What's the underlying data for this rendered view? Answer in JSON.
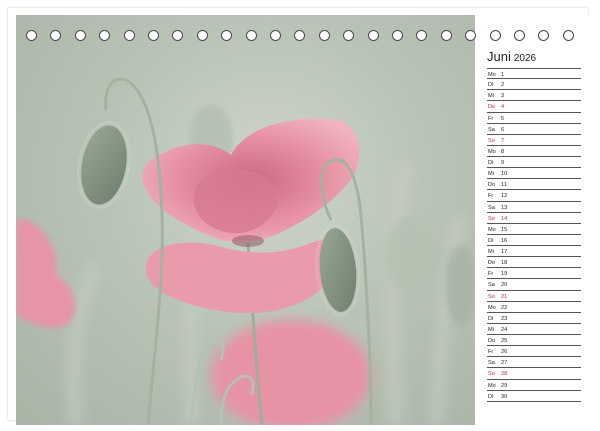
{
  "calendar": {
    "month": "Juni",
    "year": "2026",
    "ring_count": 23,
    "holiday_color": "#c8283a",
    "days": [
      {
        "wd": "Mo",
        "dn": "1",
        "hol": false
      },
      {
        "wd": "Di",
        "dn": "2",
        "hol": false
      },
      {
        "wd": "Mi",
        "dn": "3",
        "hol": false
      },
      {
        "wd": "Do",
        "dn": "4",
        "hol": true
      },
      {
        "wd": "Fr",
        "dn": "5",
        "hol": false
      },
      {
        "wd": "Sa",
        "dn": "6",
        "hol": false
      },
      {
        "wd": "So",
        "dn": "7",
        "hol": true
      },
      {
        "wd": "Mo",
        "dn": "8",
        "hol": false
      },
      {
        "wd": "Di",
        "dn": "9",
        "hol": false
      },
      {
        "wd": "Mi",
        "dn": "10",
        "hol": false
      },
      {
        "wd": "Do",
        "dn": "11",
        "hol": false
      },
      {
        "wd": "Fr",
        "dn": "12",
        "hol": false
      },
      {
        "wd": "Sa",
        "dn": "13",
        "hol": false
      },
      {
        "wd": "So",
        "dn": "14",
        "hol": true
      },
      {
        "wd": "Mo",
        "dn": "15",
        "hol": false
      },
      {
        "wd": "Di",
        "dn": "16",
        "hol": false
      },
      {
        "wd": "Mi",
        "dn": "17",
        "hol": false
      },
      {
        "wd": "Do",
        "dn": "18",
        "hol": false
      },
      {
        "wd": "Fr",
        "dn": "19",
        "hol": false
      },
      {
        "wd": "Sa",
        "dn": "20",
        "hol": false
      },
      {
        "wd": "So",
        "dn": "21",
        "hol": true
      },
      {
        "wd": "Mo",
        "dn": "22",
        "hol": false
      },
      {
        "wd": "Di",
        "dn": "23",
        "hol": false
      },
      {
        "wd": "Mi",
        "dn": "24",
        "hol": false
      },
      {
        "wd": "Do",
        "dn": "25",
        "hol": false
      },
      {
        "wd": "Fr",
        "dn": "26",
        "hol": false
      },
      {
        "wd": "Sa",
        "dn": "27",
        "hol": false
      },
      {
        "wd": "So",
        "dn": "28",
        "hol": true
      },
      {
        "wd": "Mo",
        "dn": "29",
        "hol": false
      },
      {
        "wd": "Di",
        "dn": "30",
        "hol": false
      }
    ]
  },
  "photo": {
    "subject": "pink-poppy-with-buds",
    "petal_color": "#e58ea1",
    "stem_color": "#aab8a4"
  }
}
